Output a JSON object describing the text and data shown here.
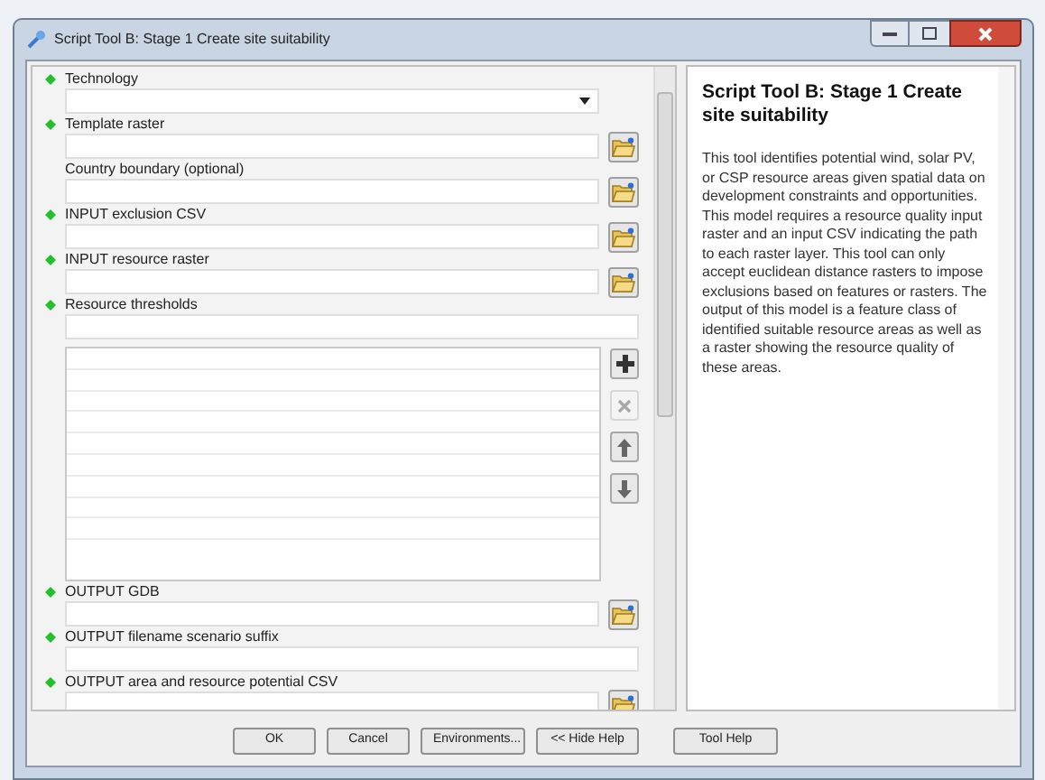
{
  "window": {
    "title": "Script Tool B: Stage 1 Create site suitability"
  },
  "parameters": [
    {
      "label": "Technology",
      "required": true,
      "kind": "dropdown"
    },
    {
      "label": "Template raster",
      "required": true,
      "kind": "file"
    },
    {
      "label": "Country boundary (optional)",
      "required": false,
      "kind": "file"
    },
    {
      "label": "INPUT exclusion CSV",
      "required": true,
      "kind": "file"
    },
    {
      "label": "INPUT resource raster",
      "required": true,
      "kind": "file"
    },
    {
      "label": "Resource thresholds",
      "required": true,
      "kind": "table",
      "table_buttons": [
        {
          "kind": "add",
          "disabled": false
        },
        {
          "kind": "delete",
          "disabled": true
        },
        {
          "kind": "up",
          "disabled": false
        },
        {
          "kind": "down",
          "disabled": false
        }
      ]
    },
    {
      "label": "OUTPUT GDB",
      "required": true,
      "kind": "file"
    },
    {
      "label": "OUTPUT filename scenario suffix",
      "required": true,
      "kind": "text"
    },
    {
      "label": "OUTPUT area and resource potential CSV",
      "required": true,
      "kind": "file"
    }
  ],
  "help": {
    "title": "Script Tool B: Stage 1 Create site suitability",
    "body": "This tool identifies potential wind, solar PV, or CSP resource areas given spatial data on development constraints and opportunities. This model requires a resource quality input raster and an input CSV indicating the path to each raster layer. This tool can only accept euclidean distance rasters to impose exclusions based on features or rasters. The output of this model is a feature class of identified suitable resource areas as well as a raster showing the resource quality of these areas."
  },
  "buttons": [
    "OK",
    "Cancel",
    "Environments...",
    "<< Hide Help"
  ],
  "help_button": "Tool Help"
}
